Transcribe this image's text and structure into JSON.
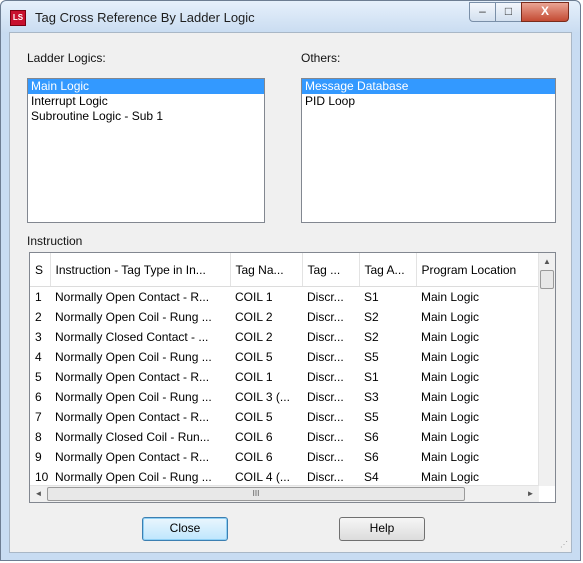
{
  "window": {
    "title": "Tag Cross Reference By Ladder Logic",
    "icon_text": "LS",
    "controls": {
      "minimize": "‒",
      "maximize": "□",
      "close": "X"
    }
  },
  "ladder_logics": {
    "label": "Ladder Logics:",
    "items": [
      "Main Logic",
      "Interrupt Logic",
      "Subroutine Logic - Sub 1"
    ],
    "selected": "Main Logic"
  },
  "others": {
    "label": "Others:",
    "items": [
      "Message Database",
      "PID Loop"
    ],
    "selected": "Message Database"
  },
  "instruction": {
    "label": "Instruction",
    "columns": [
      "S",
      "Instruction - Tag Type in In...",
      "Tag Na...",
      "Tag ...",
      "Tag A...",
      "Program Location"
    ],
    "rows": [
      [
        "1",
        "Normally Open Contact - R...",
        "COIL 1",
        "Discr...",
        "S1",
        "Main Logic"
      ],
      [
        "2",
        "Normally Open Coil - Rung ...",
        "COIL 2",
        "Discr...",
        "S2",
        "Main Logic"
      ],
      [
        "3",
        "Normally Closed Contact - ...",
        "COIL 2",
        "Discr...",
        "S2",
        "Main Logic"
      ],
      [
        "4",
        "Normally Open Coil - Rung ...",
        "COIL 5",
        "Discr...",
        "S5",
        "Main Logic"
      ],
      [
        "5",
        "Normally Open Contact - R...",
        "COIL 1",
        "Discr...",
        "S1",
        "Main Logic"
      ],
      [
        "6",
        "Normally Open Coil - Rung ...",
        "COIL 3 (...",
        "Discr...",
        "S3",
        "Main Logic"
      ],
      [
        "7",
        "Normally Open Contact - R...",
        "COIL 5",
        "Discr...",
        "S5",
        "Main Logic"
      ],
      [
        "8",
        "Normally Closed Coil - Run...",
        "COIL 6",
        "Discr...",
        "S6",
        "Main Logic"
      ],
      [
        "9",
        "Normally Open Contact - R...",
        "COIL 6",
        "Discr...",
        "S6",
        "Main Logic"
      ],
      [
        "10",
        "Normally Open Coil - Rung ...",
        "COIL 4 (...",
        "Discr...",
        "S4",
        "Main Logic"
      ]
    ],
    "scroll": {
      "up": "▲",
      "left": "◄",
      "right": "►",
      "thumb_grip": "III"
    }
  },
  "buttons": {
    "close": "Close",
    "help": "Help"
  }
}
